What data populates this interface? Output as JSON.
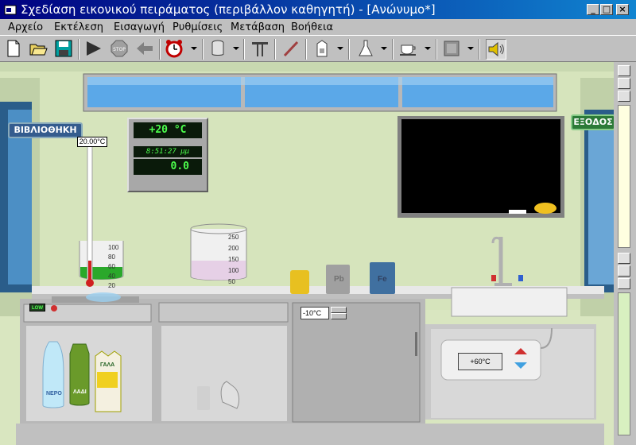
{
  "window": {
    "title": "Σχεδίαση εικονικού πειράματος (περιβάλλον καθηγητή) - [Ανώνυμο*]",
    "minimize": "_",
    "maximize": "□",
    "close": "×"
  },
  "menu": [
    "Αρχείο",
    "Εκτέλεση",
    "Εισαγωγή",
    "Ρυθμίσεις",
    "Μετάβαση",
    "Βοήθεια"
  ],
  "toolbar": {
    "icons": [
      "new-file-icon",
      "open-folder-icon",
      "save-icon",
      "play-icon",
      "stop-icon",
      "back-arrow-icon",
      "alarm-clock-icon",
      "cylinder-icon",
      "stand-icon",
      "stirring-rod-icon",
      "carton-icon",
      "flask-icon",
      "cup-icon",
      "block-icon",
      "speaker-icon"
    ]
  },
  "lab": {
    "library_sign": "ΒΙΒΛΙΟΘΗΚΗ",
    "exit_sign": "ΕΞΟΔΟΣ",
    "thermometer_reading": "20.00°C",
    "room_temp": "+20 °C",
    "clock_time": "8:51:27 μμ",
    "timer_value": "0.0",
    "small_beaker_scale": [
      "100",
      "80",
      "60",
      "40",
      "20"
    ],
    "large_beaker_scale": [
      "250",
      "200",
      "150",
      "100",
      "50"
    ],
    "burner_level": "LOW",
    "fridge_temp": "-10°C",
    "heater_temp": "+60°C",
    "jar_labels": [
      "Pb",
      "Fe"
    ],
    "bottle_labels": [
      "ΝΕΡΟ",
      "ΛΑΔΙ",
      "ΓΑΛΑ"
    ]
  }
}
